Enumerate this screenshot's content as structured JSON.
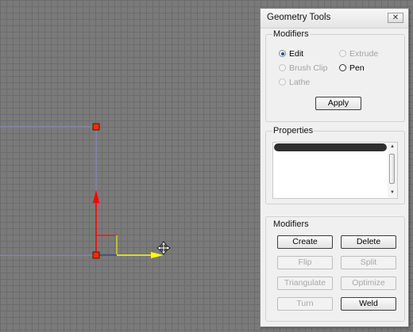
{
  "window": {
    "title": "Geometry Tools"
  },
  "close_glyph": "✕",
  "modifiers_group": {
    "title": "Modifiers",
    "options": {
      "edit": "Edit",
      "extrude": "Extrude",
      "brush_clip": "Brush Clip",
      "pen": "Pen",
      "lathe": "Lathe"
    },
    "selected": "Edit",
    "apply_label": "Apply"
  },
  "properties_group": {
    "title": "Properties"
  },
  "modifiers_buttons": {
    "title": "Modifiers",
    "create": "Create",
    "delete": "Delete",
    "flip": "Flip",
    "split": "Split",
    "triangulate": "Triangulate",
    "optimize": "Optimize",
    "turn": "Turn",
    "weld": "Weld"
  },
  "colors": {
    "vertex_handle": "#e8300c",
    "axis_y": "#ff0000",
    "axis_x": "#ffff00",
    "outline": "#8c8cd8",
    "selected_radio": "#1b4f9a"
  },
  "icons": {
    "move_cursor": "move-cursor-icon"
  }
}
